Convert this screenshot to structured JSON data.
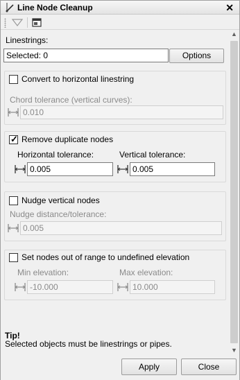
{
  "window": {
    "title": "Line Node Cleanup",
    "close_glyph": "✕"
  },
  "toolbar": {
    "items": [
      "filter-icon",
      "panel-icon"
    ]
  },
  "linestrings": {
    "label": "Linestrings:",
    "selected_value": "Selected: 0",
    "options_label": "Options"
  },
  "horizontal": {
    "checkbox_label": "Convert to horizontal linestring",
    "checked": false,
    "chord_label": "Chord tolerance (vertical curves):",
    "chord_value": "0.010"
  },
  "duplicates": {
    "checkbox_label": "Remove duplicate nodes",
    "checked": true,
    "horizontal_label": "Horizontal tolerance:",
    "horizontal_value": "0.005",
    "vertical_label": "Vertical tolerance:",
    "vertical_value": "0.005"
  },
  "nudge": {
    "checkbox_label": "Nudge vertical nodes",
    "checked": false,
    "distance_label": "Nudge distance/tolerance:",
    "distance_value": "0.005"
  },
  "range": {
    "checkbox_label": "Set nodes out of range to undefined elevation",
    "checked": false,
    "min_label": "Min elevation:",
    "min_value": "-10.000",
    "max_label": "Max elevation:",
    "max_value": "10.000"
  },
  "tip": {
    "title": "Tip!",
    "text": "Selected objects must be linestrings or pipes."
  },
  "footer": {
    "apply_label": "Apply",
    "close_label": "Close"
  }
}
